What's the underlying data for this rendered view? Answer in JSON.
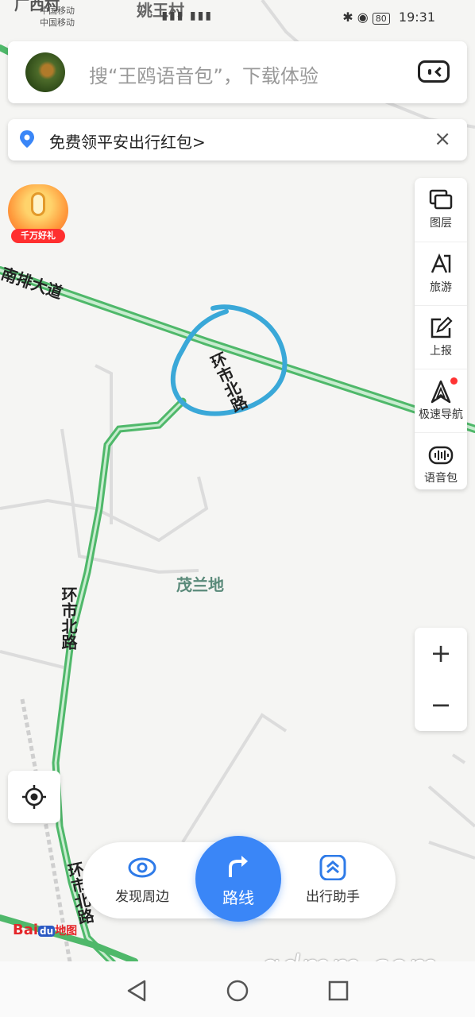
{
  "status_bar": {
    "carrier_1": "中国移动",
    "carrier_2": "中国移动",
    "battery": "80",
    "time": "19:31"
  },
  "search": {
    "placeholder": "搜“王鸥语音包”，下载体验",
    "voice_icon": "voice-assistant-icon"
  },
  "promo": {
    "text": "免费领平安出行红包>",
    "close": "×"
  },
  "gift": {
    "label": "千万好礼"
  },
  "toolbar": {
    "items": [
      {
        "label": "图层",
        "icon": "layers-icon"
      },
      {
        "label": "旅游",
        "icon": "travel-icon"
      },
      {
        "label": "上报",
        "icon": "report-icon"
      },
      {
        "label": "极速导航",
        "icon": "navigation-icon"
      },
      {
        "label": "语音包",
        "icon": "voice-pack-icon"
      }
    ]
  },
  "zoom": {
    "in": "+",
    "out": "−"
  },
  "map_labels": {
    "top_left": "广西村",
    "top_village": "姚王村",
    "road_nanpai": "南排大道",
    "road_huanshi_upper": "环市北路",
    "area": "茂兰地",
    "road_huanshi_left": "环市北路",
    "road_huanshi_bottom": "环市北路"
  },
  "bottom_bar": {
    "discover": "发现周边",
    "route": "路线",
    "assistant": "出行助手"
  },
  "logo": {
    "bai": "Bai",
    "du": "du",
    "map": "地图"
  },
  "watermark": "gdmm.com",
  "colors": {
    "accent": "#3a86f7",
    "road_green": "#5cc87a",
    "annotation_circle": "#3aa8d8"
  }
}
